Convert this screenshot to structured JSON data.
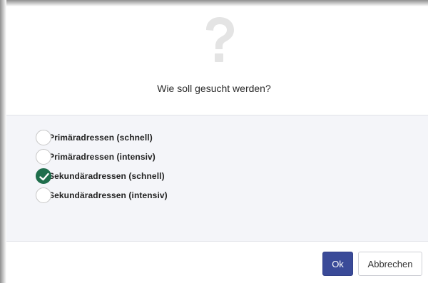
{
  "dialog": {
    "title": "Wie soll gesucht werden?",
    "icon": "question-mark-icon",
    "icon_color": "#e4e4e4"
  },
  "options": [
    {
      "label": "Primäradressen (schnell)",
      "selected": false
    },
    {
      "label": "Primäradressen (intensiv)",
      "selected": false
    },
    {
      "label": "Sekundäradressen (schnell)",
      "selected": true
    },
    {
      "label": "Sekundäradressen (intensiv)",
      "selected": false
    }
  ],
  "buttons": {
    "ok_label": "Ok",
    "cancel_label": "Abbrechen"
  },
  "colors": {
    "primary": "#3a4a98",
    "selected_radio": "#1f6e4c",
    "body_background": "#f4f5f9"
  }
}
